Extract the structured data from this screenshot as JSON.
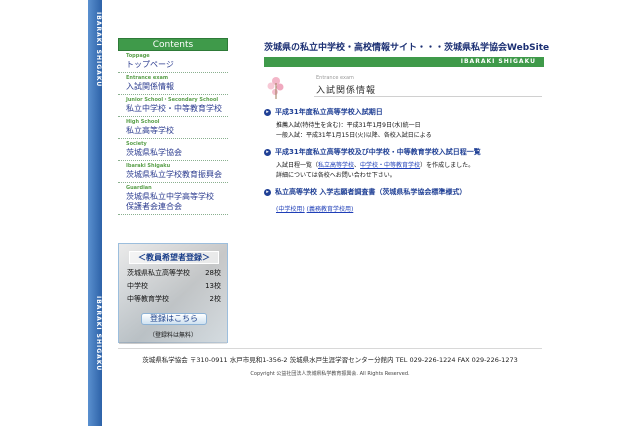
{
  "side_band": {
    "top_text": "IBARAKI SHIGAKU",
    "bottom_text": "IBARAKI SHIGAKU"
  },
  "header": {
    "title": "茨城県の私立中学校・高校情報サイト・・・茨城県私学協会WebSite",
    "subtitle": "IBARAKI SHIGAKU"
  },
  "menu": {
    "title": "Contents",
    "items": [
      {
        "en": "Toppage",
        "jp": "トップページ"
      },
      {
        "en": "Entrance exam",
        "jp": "入試関係情報"
      },
      {
        "en": "Junior School・Secondary School",
        "jp": "私立中学校・中等教育学校"
      },
      {
        "en": "High School",
        "jp": "私立高等学校"
      },
      {
        "en": "Society",
        "jp": "茨城県私学協会"
      },
      {
        "en": "Ibaraki Shigaku",
        "jp": "茨城県私立学校教育振興会"
      },
      {
        "en": "Guardian",
        "jp": "茨城県私立中学高等学校",
        "jp2": "保護者会連合会"
      }
    ]
  },
  "teacher": {
    "title": "＜教員希望者登録＞",
    "rows": [
      {
        "label": "茨城県私立高等学校",
        "value": "28校"
      },
      {
        "label": "中学校",
        "value": "13校"
      },
      {
        "label": "中等教育学校",
        "value": "2校"
      }
    ],
    "button": "登録はこちら",
    "note": "（登録料は無料）"
  },
  "content": {
    "heading_en": "Entrance exam",
    "heading_jp": "入試関係情報",
    "sections": [
      {
        "title": "平成31年度私立高等学校入試期日",
        "lines": [
          "推薦入試(特待生を含む)：平成31年1月9日(水)統一日",
          "一般入試：平成31年1月15日(火)以降、各校入試日による"
        ]
      },
      {
        "title": "平成31年度私立高等学校及び中学校・中等教育学校入試日程一覧",
        "pre": "入試日程一覧（",
        "link1": "私立高等学校",
        "sep": "、",
        "link2": "中学校・中等教育学校",
        "post": "）を作成しました。",
        "line2": "詳細については各校へお問い合わせ下さい。"
      },
      {
        "title": "私立高等学校 入学志願者調査書（茨城県私学協会標準様式）",
        "link1": "(中学校用)",
        "link2": "(義務教育学校用)"
      }
    ]
  },
  "footer": {
    "address": "茨城県私学協会 〒310-0911 水戸市見和1-356-2 茨城県水戸生涯学習センター分館内 TEL 029-226-1224 FAX 029-226-1273",
    "copyright": "Copyright 公益社団法人茨城県私学教育振興会. All Rights Reserved."
  },
  "colors": {
    "accent_green": "#3f9a4a",
    "band_blue": "#2d62a8",
    "link_blue": "#1f3fb8",
    "heading_navy": "#1b2f73"
  }
}
